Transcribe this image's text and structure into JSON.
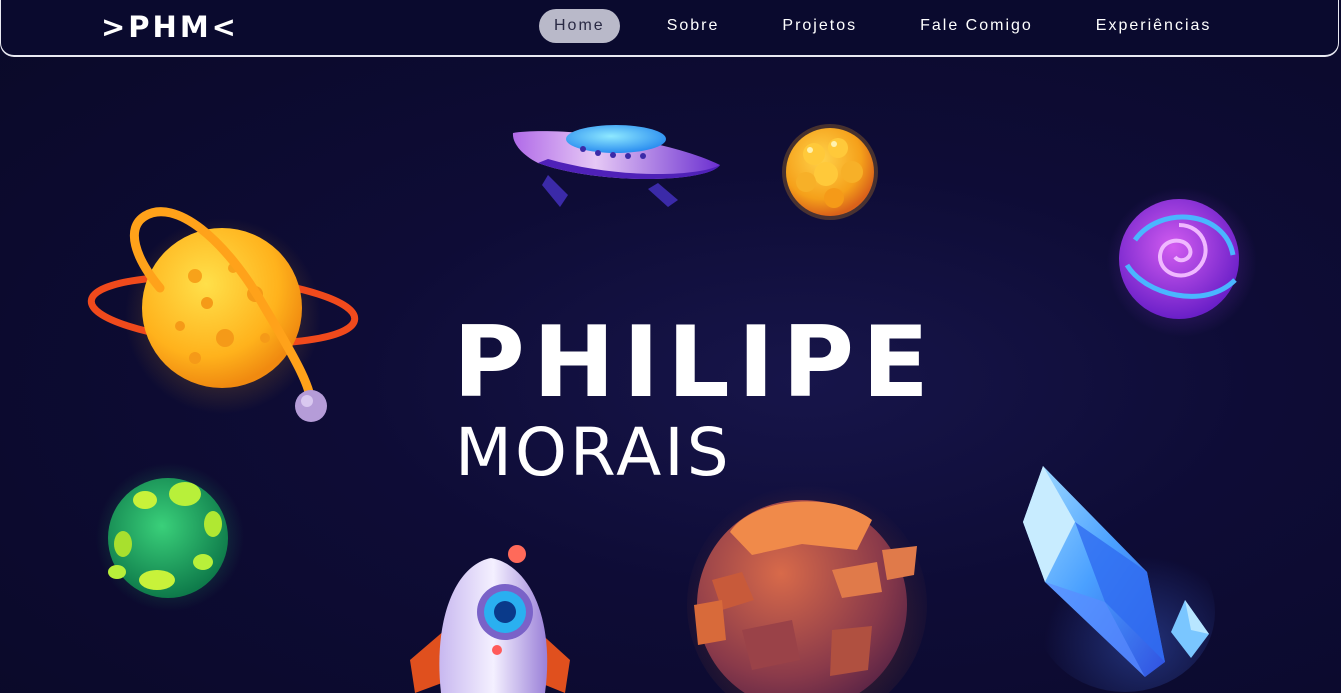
{
  "header": {
    "logo": ">PHM<",
    "nav": [
      {
        "label": "Home",
        "active": true
      },
      {
        "label": "Sobre",
        "active": false
      },
      {
        "label": "Projetos",
        "active": false
      },
      {
        "label": "Fale Comigo",
        "active": false
      },
      {
        "label": "Experiências",
        "active": false
      }
    ]
  },
  "hero": {
    "first_name": "PHILIPE",
    "last_name": "MORAIS"
  },
  "colors": {
    "background": "#0b0a2a",
    "header_border": "#e9e9f2",
    "nav_active_bg": "#b9b9c9",
    "text": "#ffffff"
  },
  "illustrations": [
    "ringed-sun-planet-icon",
    "ufo-icon",
    "golden-asteroid-icon",
    "purple-swirl-planet-icon",
    "green-planet-icon",
    "rocket-icon",
    "rocky-planet-icon",
    "crystal-icon"
  ]
}
